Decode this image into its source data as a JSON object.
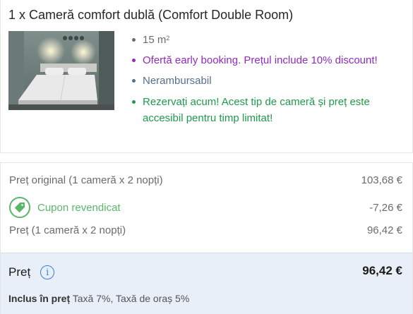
{
  "room": {
    "title": "1 x Cameră comfort dublă (Comfort Double Room)",
    "size_value": "15 m",
    "size_sup": "2",
    "offer": "Ofertă early booking. Prețul include 10% discount!",
    "refund": "Nerambursabil",
    "urgency": "Rezervați acum! Acest tip de cameră și preț este accesibil pentru timp limitat!"
  },
  "price": {
    "original_label": "Preț original (1 cameră x 2 nopți)",
    "original_value": "103,68 €",
    "coupon_label": "Cupon revendicat",
    "coupon_value": "-7,26 €",
    "subtotal_label": "Preț (1 cameră x 2 nopți)",
    "subtotal_value": "96,42 €",
    "total_label": "Preț",
    "total_value": "96,42 €",
    "included_label": "Inclus în preț",
    "included_text": "Taxă 7%, Taxă de oraș 5%"
  },
  "icons": {
    "coupon": "tag-icon",
    "info": "info-icon"
  },
  "colors": {
    "offer": "#8f2bbd",
    "urgency": "#1f9a4a",
    "coupon": "#5ab66a",
    "info": "#3b7fd4",
    "total_background": "#e8eff8"
  }
}
